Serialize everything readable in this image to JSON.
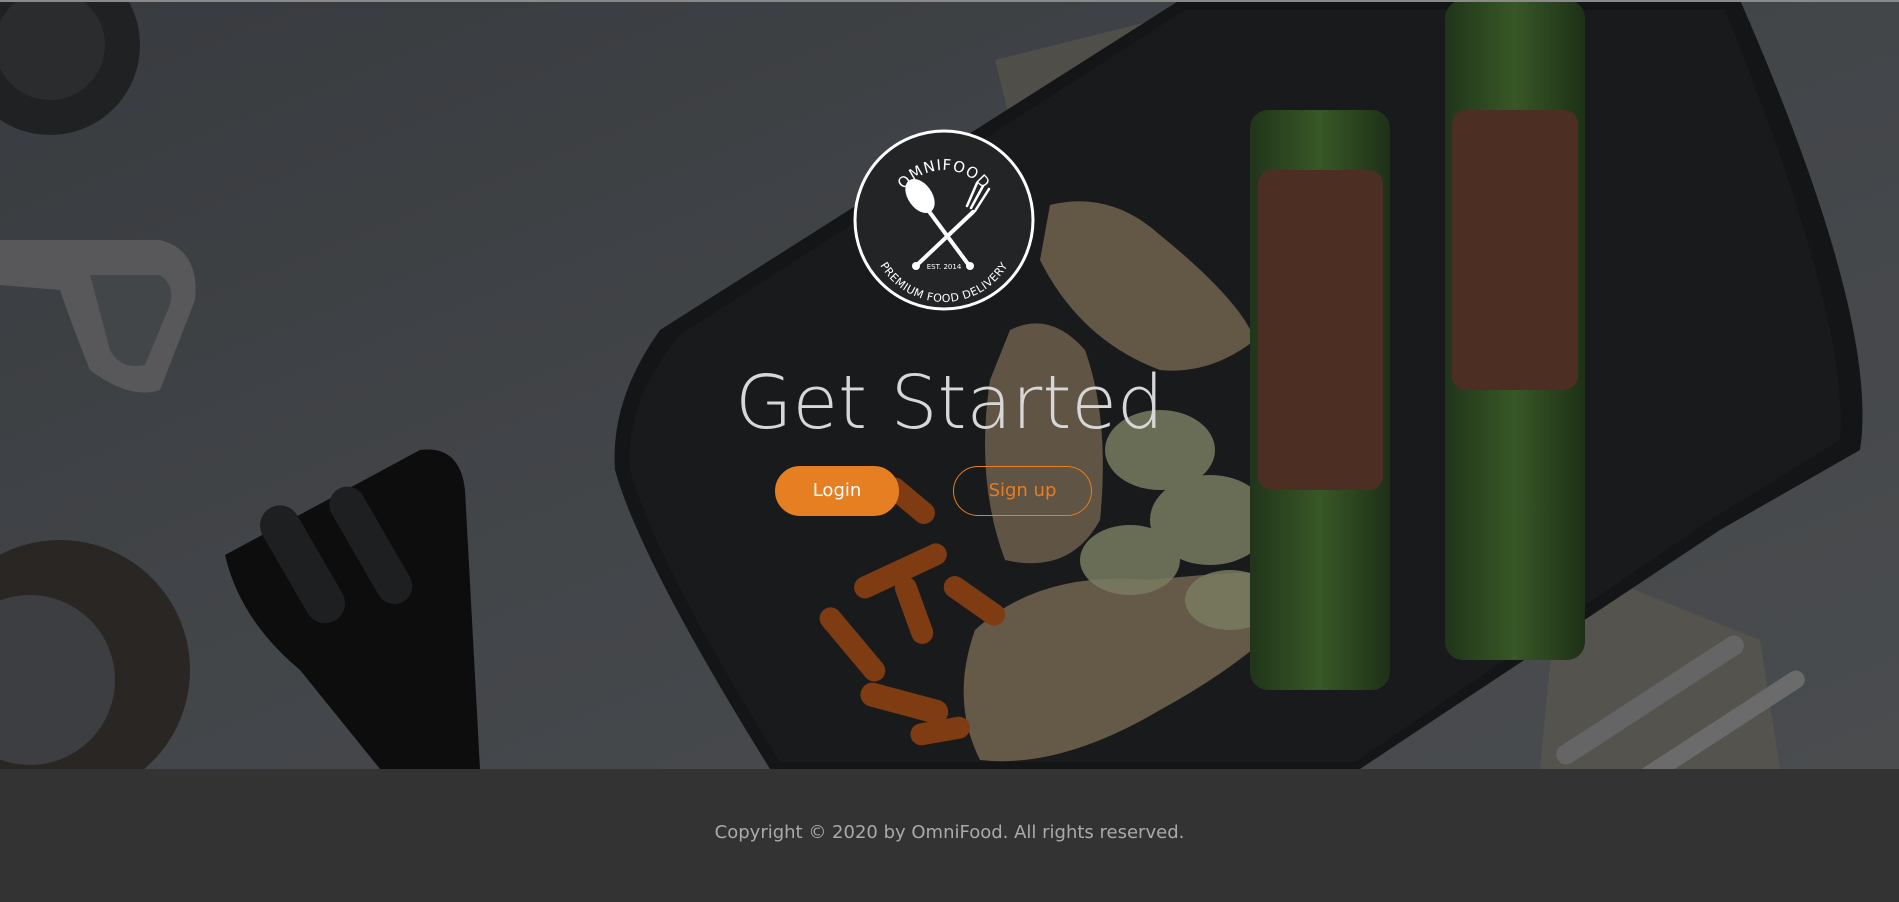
{
  "hero": {
    "heading": "Get Started",
    "logo": {
      "brand": "OMNIFOOD",
      "est": "EST. 2014",
      "tagline": "PREMIUM FOOD DELIVERY"
    },
    "buttons": {
      "login_label": "Login",
      "signup_label": "Sign up"
    }
  },
  "footer": {
    "copyright": "Copyright © 2020 by OmniFood. All rights reserved."
  },
  "colors": {
    "accent": "#e67e22",
    "footer_bg": "#333333",
    "heading_text": "#d7d7d7",
    "footer_text": "#aaaaaa"
  },
  "icons": [
    "spoon-icon",
    "fork-icon"
  ]
}
